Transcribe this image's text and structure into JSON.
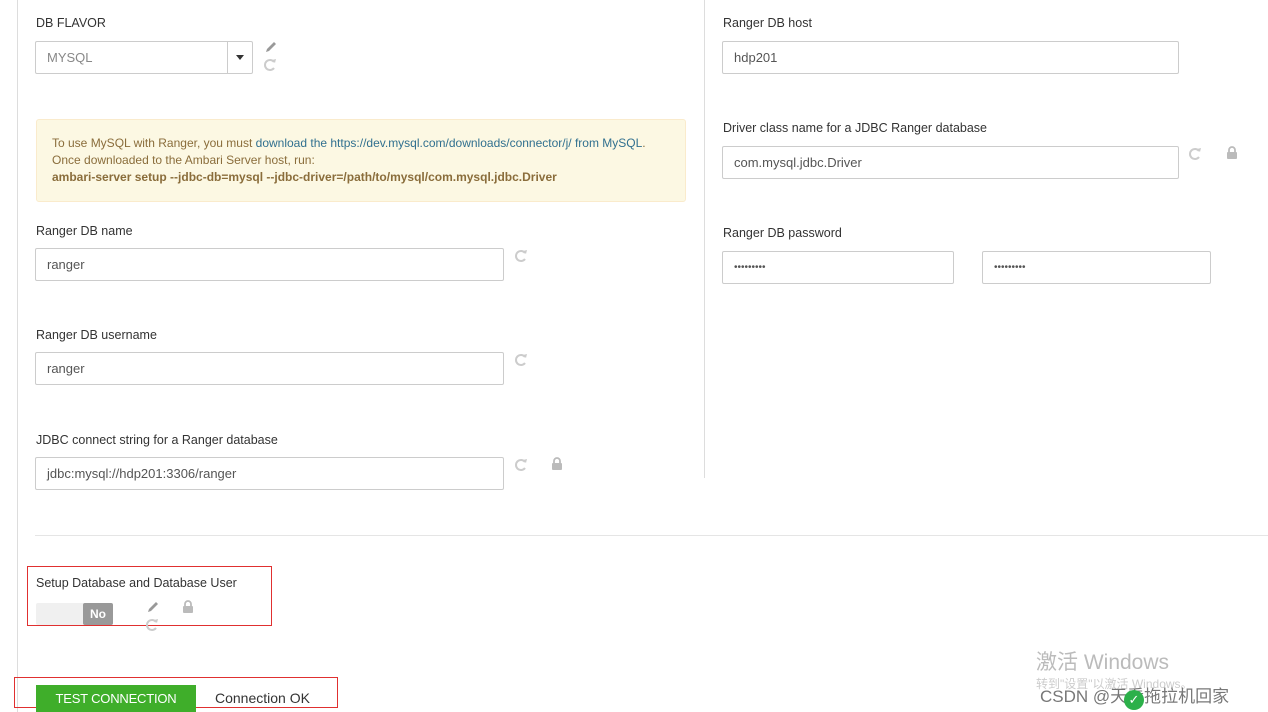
{
  "left": {
    "db_flavor": {
      "label": "DB FLAVOR",
      "value": "MYSQL"
    },
    "notice": {
      "prefix": "To use MySQL with Ranger, you must ",
      "link": "download the https://dev.mysql.com/downloads/connector/j/ from MySQL",
      "middle": ". Once downloaded to the Ambari Server host, run:",
      "command": "ambari-server setup --jdbc-db=mysql --jdbc-driver=/path/to/mysql/com.mysql.jdbc.Driver"
    },
    "db_name": {
      "label": "Ranger DB name",
      "value": "ranger"
    },
    "db_username": {
      "label": "Ranger DB username",
      "value": "ranger"
    },
    "jdbc_string": {
      "label": "JDBC connect string for a Ranger database",
      "value": "jdbc:mysql://hdp201:3306/ranger"
    }
  },
  "right": {
    "db_host": {
      "label": "Ranger DB host",
      "value": "hdp201"
    },
    "driver_class": {
      "label": "Driver class name for a JDBC Ranger database",
      "value": "com.mysql.jdbc.Driver"
    },
    "db_password": {
      "label": "Ranger DB password",
      "value1": "•••••••••",
      "value2": "•••••••••"
    }
  },
  "setup_db": {
    "label": "Setup Database and Database User",
    "toggle_label": "No"
  },
  "test": {
    "button_label": "TEST CONNECTION",
    "status": "Connection OK"
  },
  "watermark": {
    "activate_title": "激活 Windows",
    "activate_sub": "转到\"设置\"以激活 Windows。",
    "csdn": "CSDN @天看拖拉机回家"
  },
  "colors": {
    "accent": "#3fae2a",
    "link": "#31708f",
    "notice_bg": "#fcf8e3",
    "highlight": "#e03030"
  },
  "icons": [
    "pencil-icon",
    "undo-icon",
    "lock-icon",
    "caret-down-icon"
  ]
}
